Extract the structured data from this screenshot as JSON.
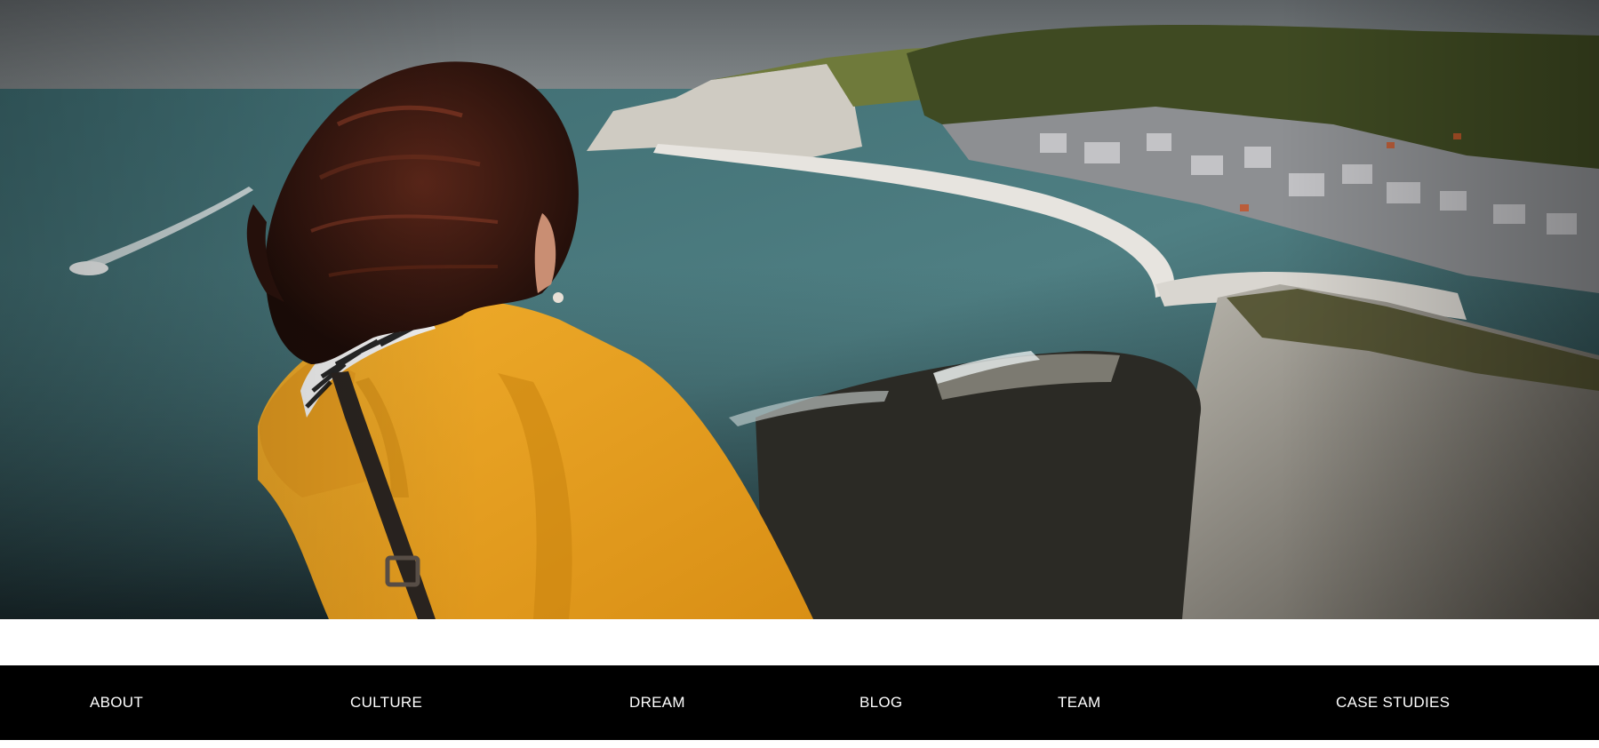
{
  "hero": {
    "image": "woman-in-yellow-raincoat-overlooking-coastal-cliffs-and-town"
  },
  "nav": {
    "background_color": "#000000",
    "text_color": "#ffffff",
    "items": [
      {
        "label": "ABOUT"
      },
      {
        "label": "CULTURE"
      },
      {
        "label": "DREAM"
      },
      {
        "label": "BLOG"
      },
      {
        "label": "TEAM"
      },
      {
        "label": "CASE STUDIES"
      }
    ]
  }
}
